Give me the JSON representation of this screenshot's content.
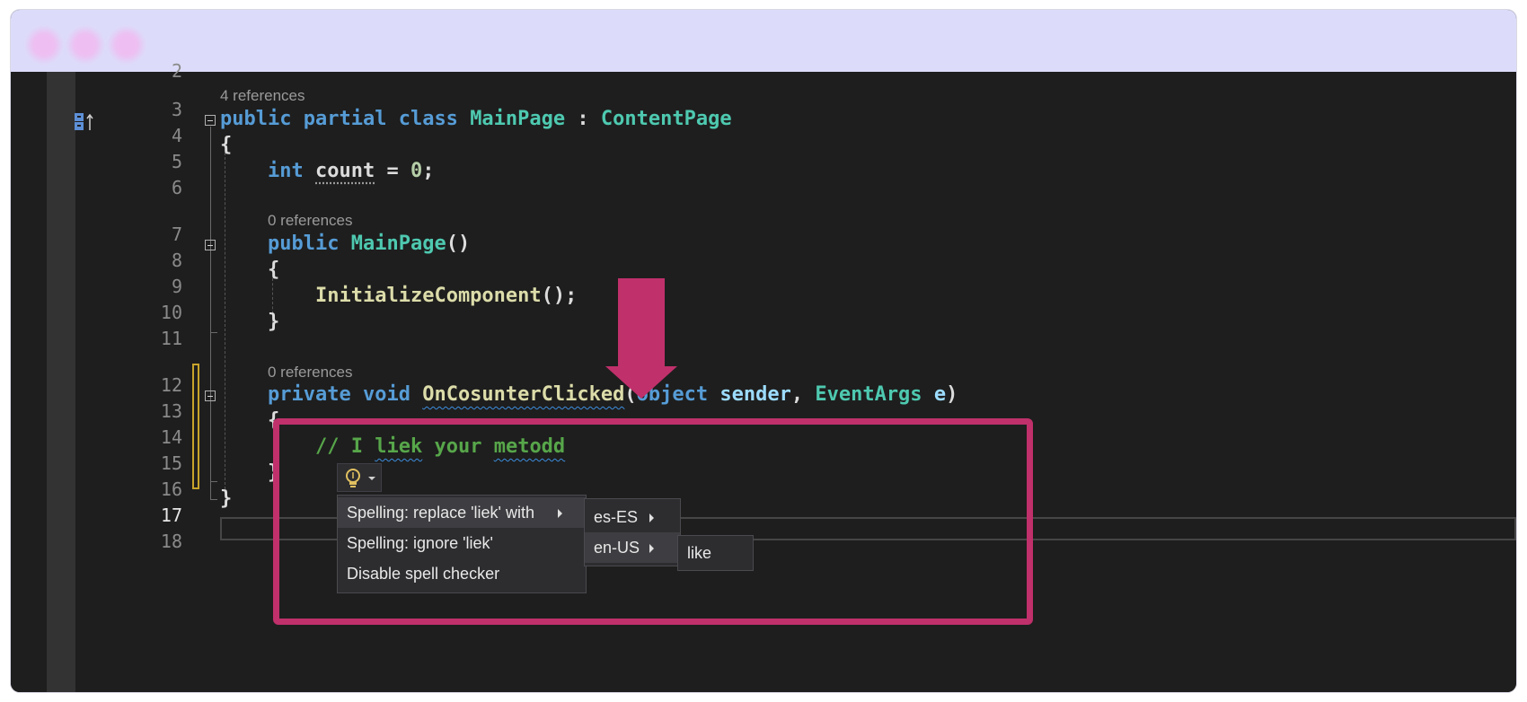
{
  "editor": {
    "line_numbers": [
      "2",
      "3",
      "4",
      "5",
      "6",
      "7",
      "8",
      "9",
      "10",
      "11",
      "12",
      "13",
      "14",
      "15",
      "16",
      "17",
      "18"
    ],
    "active_line": "17",
    "code_lens": {
      "class_refs": "4 references",
      "ctor_refs": "0 references",
      "method_refs": "0 references"
    },
    "code": {
      "l3_public": "public",
      "l3_partial": "partial",
      "l3_class": "class",
      "l3_name": "MainPage",
      "l3_colon": ":",
      "l3_base": "ContentPage",
      "l4": "{",
      "l5_type": "int",
      "l5_var": "count",
      "l5_rest": "= ",
      "l5_num": "0",
      "l5_end": ";",
      "l7_public": "public",
      "l7_name": "MainPage",
      "l7_parens": "()",
      "l8": "{",
      "l9_call": "InitializeComponent",
      "l9_rest": "();",
      "l10": "}",
      "l12_private": "private",
      "l12_void": "void",
      "l12_name": "OnCosunterClicked",
      "l12_open": "(",
      "l12_object": "object",
      "l12_sender": "sender",
      "l12_comma": ",",
      "l12_eventargs": "EventArgs",
      "l12_e": "e",
      "l12_close": ")",
      "l13": "{",
      "l14_comment_start": "// I ",
      "l14_liek": "liek",
      "l14_your": " your ",
      "l14_metodd": "metodd",
      "l15": "}",
      "l16": "}"
    }
  },
  "quick_actions": {
    "icon": "lightbulb-icon",
    "items": [
      {
        "label": "Spelling: replace 'liek' with",
        "has_submenu": true
      },
      {
        "label": "Spelling: ignore 'liek'",
        "has_submenu": false
      },
      {
        "label": "Disable spell checker",
        "has_submenu": false
      }
    ],
    "locales": [
      {
        "label": "es-ES"
      },
      {
        "label": "en-US"
      }
    ],
    "suggestions": [
      {
        "label": "like"
      }
    ]
  },
  "colors": {
    "highlight": "#c0306b",
    "titlebar": "#dcdcfa",
    "editor_bg": "#1e1e1e",
    "keyword": "#569cd6",
    "type": "#4ec9b0",
    "comment": "#57a64a"
  }
}
